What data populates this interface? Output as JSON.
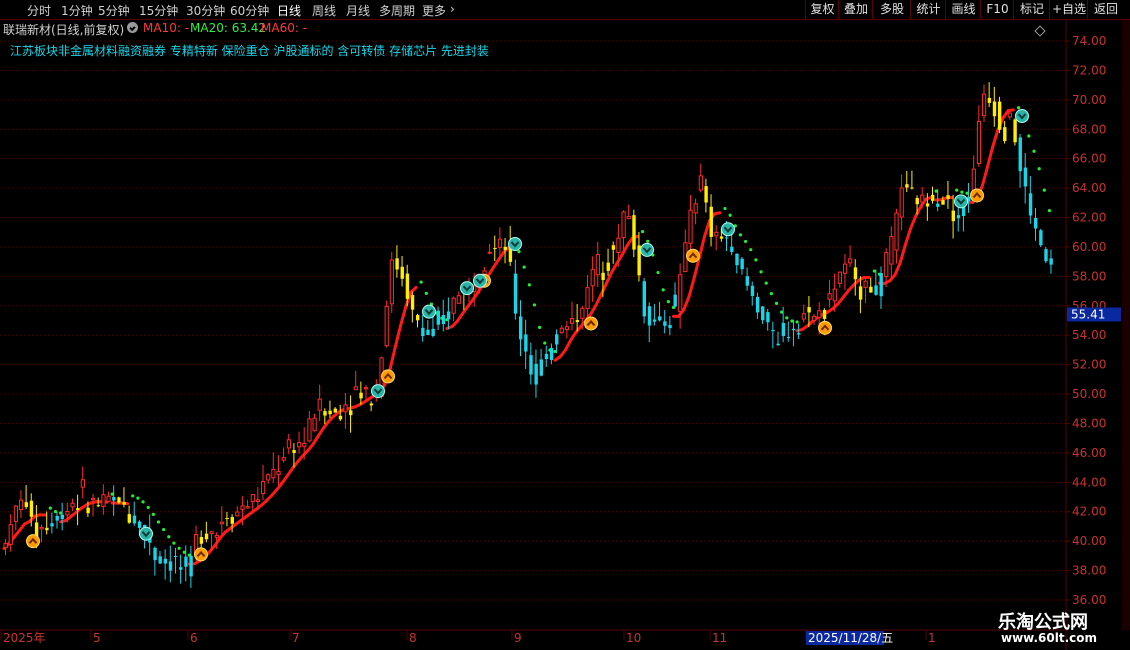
{
  "toolbar": {
    "periods": [
      "分时",
      "1分钟",
      "5分钟",
      "15分钟",
      "30分钟",
      "60分钟",
      "日线",
      "周线",
      "月线",
      "多周期",
      "更多"
    ],
    "active_period": "日线",
    "more_arrow": "›",
    "buttons": [
      "复权",
      "叠加",
      "多股",
      "统计",
      "画线",
      "F10",
      "标记",
      "+自选",
      "返回"
    ]
  },
  "info": {
    "stock_name": "联瑞新材(日线,前复权)",
    "ma10_label": "MA10: -",
    "ma20_label": "MA20: 63.42",
    "ma60_label": "MA60: -",
    "concepts": "江苏板块非金属材料融资融券 专精特新 保险重仓 沪股通标的 含可转债 存储芯片 先进封装"
  },
  "colors": {
    "up": "#ff2a2a",
    "down": "#19d5e8",
    "warn": "#ffee00",
    "ma": "#ff1a1a",
    "dot": "#22ee33",
    "grid": "#5a0000",
    "axis_text": "#c83232",
    "price_box": "#0a28a0"
  },
  "chart_data": {
    "type": "candlestick",
    "y_axis_ticks": [
      "74.00",
      "72.00",
      "70.00",
      "68.00",
      "66.00",
      "64.00",
      "62.00",
      "60.00",
      "58.00",
      "56.00",
      "54.00",
      "52.00",
      "50.00",
      "48.00",
      "46.00",
      "44.00",
      "42.00",
      "40.00",
      "38.00",
      "36.00"
    ],
    "ylim": [
      36,
      74.5
    ],
    "x_axis_labels": [
      "2025年",
      "5",
      "6",
      "7",
      "8",
      "9",
      "10",
      "11",
      "2025/11/28/五",
      "1"
    ],
    "current_price": "55.41",
    "signals_up": 10,
    "signals_down": 10
  },
  "watermark": {
    "site_name": "乐淘公式网",
    "site_url": "www.60lt.com"
  }
}
